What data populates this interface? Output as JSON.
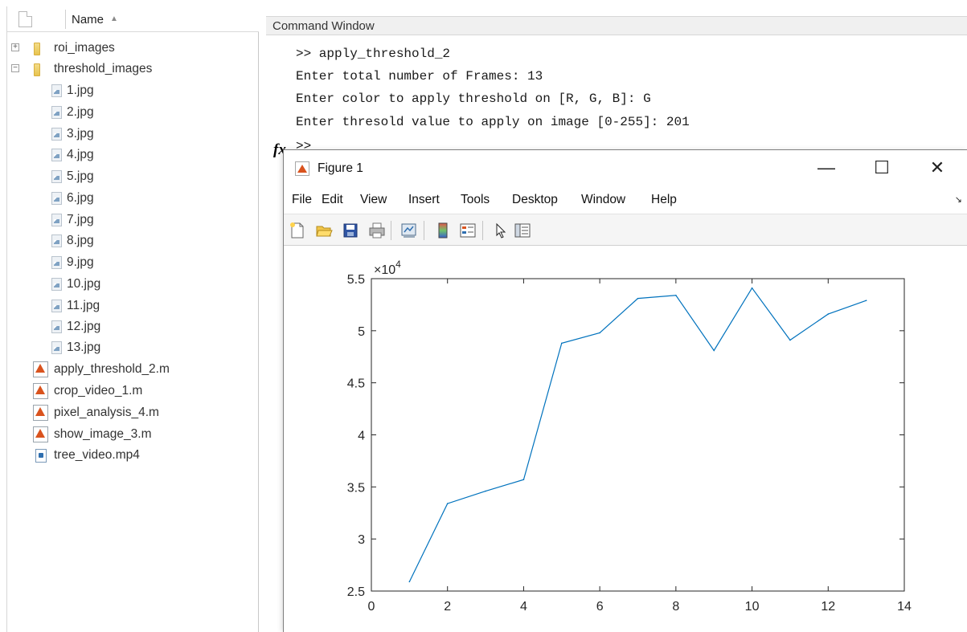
{
  "file_browser": {
    "header_label": "Name",
    "items": [
      {
        "name": "roi_images",
        "type": "folder",
        "expander": "+"
      },
      {
        "name": "threshold_images",
        "type": "folder",
        "expander": "−"
      },
      {
        "name": "1.jpg",
        "type": "jpg"
      },
      {
        "name": "2.jpg",
        "type": "jpg"
      },
      {
        "name": "3.jpg",
        "type": "jpg"
      },
      {
        "name": "4.jpg",
        "type": "jpg"
      },
      {
        "name": "5.jpg",
        "type": "jpg"
      },
      {
        "name": "6.jpg",
        "type": "jpg"
      },
      {
        "name": "7.jpg",
        "type": "jpg"
      },
      {
        "name": "8.jpg",
        "type": "jpg"
      },
      {
        "name": "9.jpg",
        "type": "jpg"
      },
      {
        "name": "10.jpg",
        "type": "jpg"
      },
      {
        "name": "11.jpg",
        "type": "jpg"
      },
      {
        "name": "12.jpg",
        "type": "jpg"
      },
      {
        "name": "13.jpg",
        "type": "jpg"
      },
      {
        "name": "apply_threshold_2.m",
        "type": "m-file"
      },
      {
        "name": "crop_video_1.m",
        "type": "m-file"
      },
      {
        "name": "pixel_analysis_4.m",
        "type": "m-file"
      },
      {
        "name": "show_image_3.m",
        "type": "m-file"
      },
      {
        "name": "tree_video.mp4",
        "type": "video"
      }
    ]
  },
  "command_window": {
    "title": "Command Window",
    "lines": [
      ">> apply_threshold_2",
      "Enter total number of Frames: 13",
      "Enter color to apply threshold on [R, G, B]: G",
      "Enter thresold value to apply on image [0-255]: 201"
    ],
    "prompt": ">>",
    "fx_label": "fx"
  },
  "figure": {
    "title": "Figure 1",
    "window_controls": {
      "minimize": "—",
      "maximize": "☐",
      "close": "✕"
    },
    "menu": [
      "File",
      "Edit",
      "View",
      "Insert",
      "Tools",
      "Desktop",
      "Window",
      "Help"
    ],
    "menu_arrow": "↘",
    "toolbar_icons": [
      "new-figure-icon",
      "open-file-icon",
      "save-icon",
      "print-icon",
      "link-plot-icon",
      "colorbar-icon",
      "legend-icon",
      "edit-plot-icon",
      "property-inspector-icon"
    ]
  },
  "chart_data": {
    "type": "line",
    "title": "",
    "xlabel": "",
    "ylabel": "",
    "y_exponent_label": "×10",
    "y_exponent_power": "4",
    "x": [
      1,
      2,
      3,
      4,
      5,
      6,
      7,
      8,
      9,
      10,
      11,
      12,
      13
    ],
    "series": [
      {
        "values": [
          2.59,
          3.34,
          3.46,
          3.57,
          4.88,
          4.98,
          5.31,
          5.34,
          4.81,
          5.41,
          4.91,
          5.16,
          5.29
        ],
        "color": "#0072bd"
      }
    ],
    "xlim": [
      0,
      14
    ],
    "ylim": [
      2.5,
      5.5
    ],
    "xticks": [
      "0",
      "2",
      "4",
      "6",
      "8",
      "10",
      "12",
      "14"
    ],
    "yticks": [
      "2.5",
      "3",
      "3.5",
      "4",
      "4.5",
      "5",
      "5.5"
    ],
    "grid": false
  }
}
